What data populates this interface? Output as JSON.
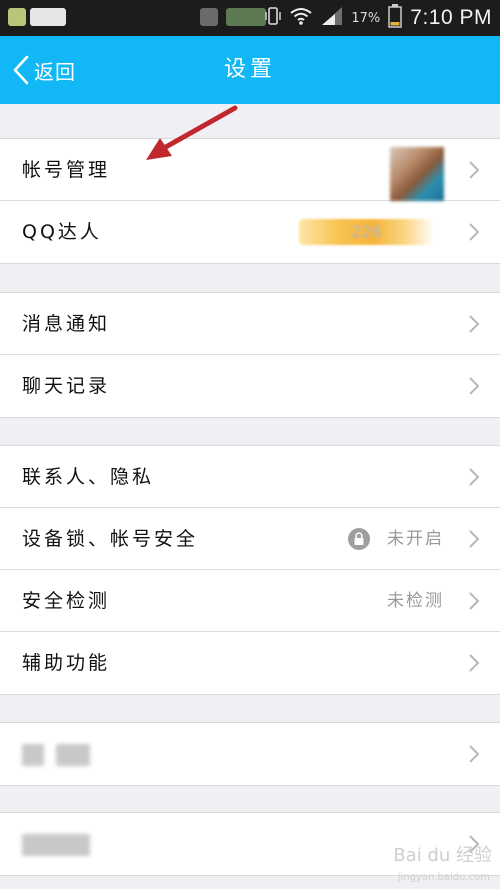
{
  "status_bar": {
    "battery_percent": "17%",
    "time": "7:10 PM"
  },
  "nav": {
    "back_label": "返回",
    "title": "设置"
  },
  "groups": [
    {
      "rows": [
        {
          "label": "帐号管理"
        },
        {
          "label": "QQ达人",
          "value": "226"
        }
      ]
    },
    {
      "rows": [
        {
          "label": "消息通知"
        },
        {
          "label": "聊天记录"
        }
      ]
    },
    {
      "rows": [
        {
          "label": "联系人、隐私"
        },
        {
          "label": "设备锁、帐号安全",
          "value": "未开启"
        },
        {
          "label": "安全检测",
          "value": "未检测"
        },
        {
          "label": "辅助功能"
        }
      ]
    }
  ],
  "watermark": {
    "text": "Bai du 经验",
    "sub": "jingyan.baidu.com"
  },
  "colors": {
    "nav_bg": "#12b7f5",
    "annotation_arrow": "#c0282d"
  }
}
